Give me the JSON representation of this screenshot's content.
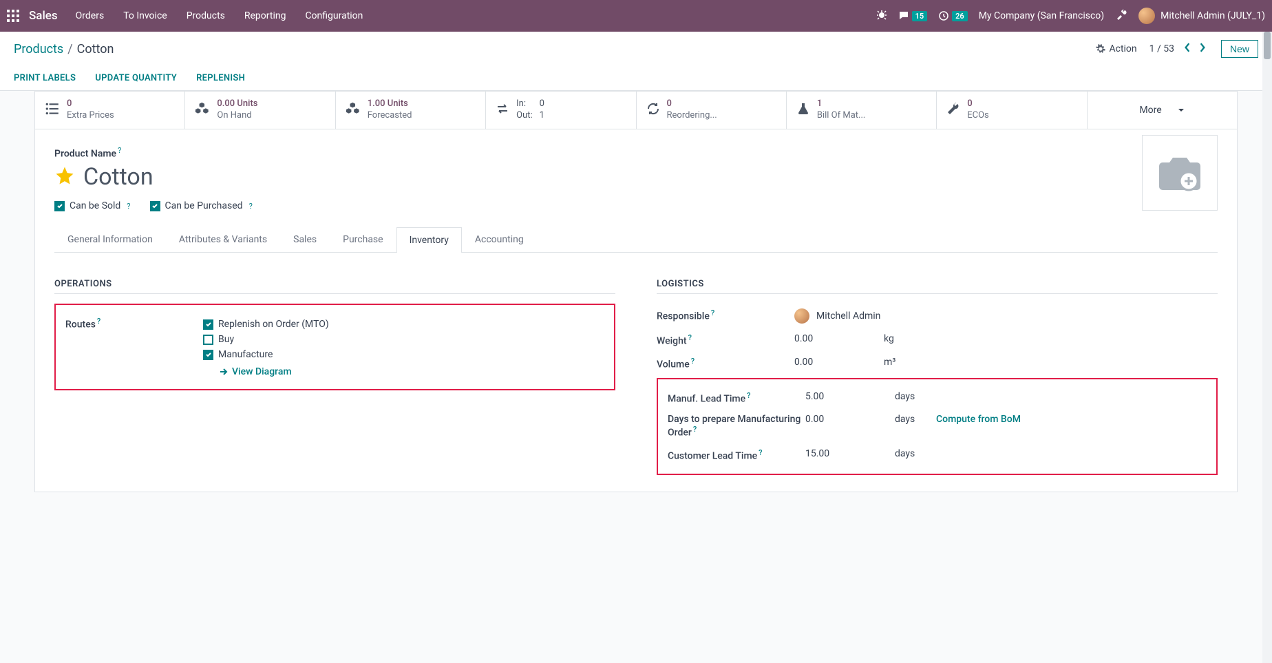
{
  "topbar": {
    "brand": "Sales",
    "menu": [
      "Orders",
      "To Invoice",
      "Products",
      "Reporting",
      "Configuration"
    ],
    "messages_badge": "15",
    "activities_badge": "26",
    "company": "My Company (San Francisco)",
    "user": "Mitchell Admin (JULY_1)"
  },
  "breadcrumb": {
    "root": "Products",
    "current": "Cotton"
  },
  "action_label": "Action",
  "pager": {
    "range": "1 / 53"
  },
  "new_btn": "New",
  "toolbar": {
    "print_labels": "PRINT LABELS",
    "update_qty": "UPDATE QUANTITY",
    "replenish": "REPLENISH"
  },
  "stats": {
    "extra_prices": {
      "top": "0",
      "bot": "Extra Prices"
    },
    "on_hand": {
      "top": "0.00 Units",
      "bot": "On Hand"
    },
    "forecasted": {
      "top": "1.00 Units",
      "bot": "Forecasted"
    },
    "inout": {
      "in_lbl": "In:",
      "in_val": "0",
      "out_lbl": "Out:",
      "out_val": "1"
    },
    "reordering": {
      "top": "0",
      "bot": "Reordering..."
    },
    "bom": {
      "top": "1",
      "bot": "Bill Of Mat..."
    },
    "ecos": {
      "top": "0",
      "bot": "ECOs"
    },
    "more": "More"
  },
  "product": {
    "label": "Product Name",
    "name": "Cotton",
    "can_be_sold": "Can be Sold",
    "can_be_purchased": "Can be Purchased"
  },
  "tabs": [
    "General Information",
    "Attributes & Variants",
    "Sales",
    "Purchase",
    "Inventory",
    "Accounting"
  ],
  "active_tab_index": 4,
  "operations": {
    "title": "OPERATIONS",
    "routes_label": "Routes",
    "routes": {
      "mto": {
        "label": "Replenish on Order (MTO)",
        "checked": true
      },
      "buy": {
        "label": "Buy",
        "checked": false
      },
      "manufacture": {
        "label": "Manufacture",
        "checked": true
      }
    },
    "view_diagram": "View Diagram"
  },
  "logistics": {
    "title": "LOGISTICS",
    "responsible": {
      "label": "Responsible",
      "value": "Mitchell Admin"
    },
    "weight": {
      "label": "Weight",
      "value": "0.00",
      "unit": "kg"
    },
    "volume": {
      "label": "Volume",
      "value": "0.00",
      "unit": "m³"
    },
    "manuf_lead": {
      "label": "Manuf. Lead Time",
      "value": "5.00",
      "unit": "days"
    },
    "days_prepare": {
      "label": "Days to prepare Manufacturing Order",
      "value": "0.00",
      "unit": "days",
      "extra": "Compute from BoM"
    },
    "cust_lead": {
      "label": "Customer Lead Time",
      "value": "15.00",
      "unit": "days"
    }
  }
}
